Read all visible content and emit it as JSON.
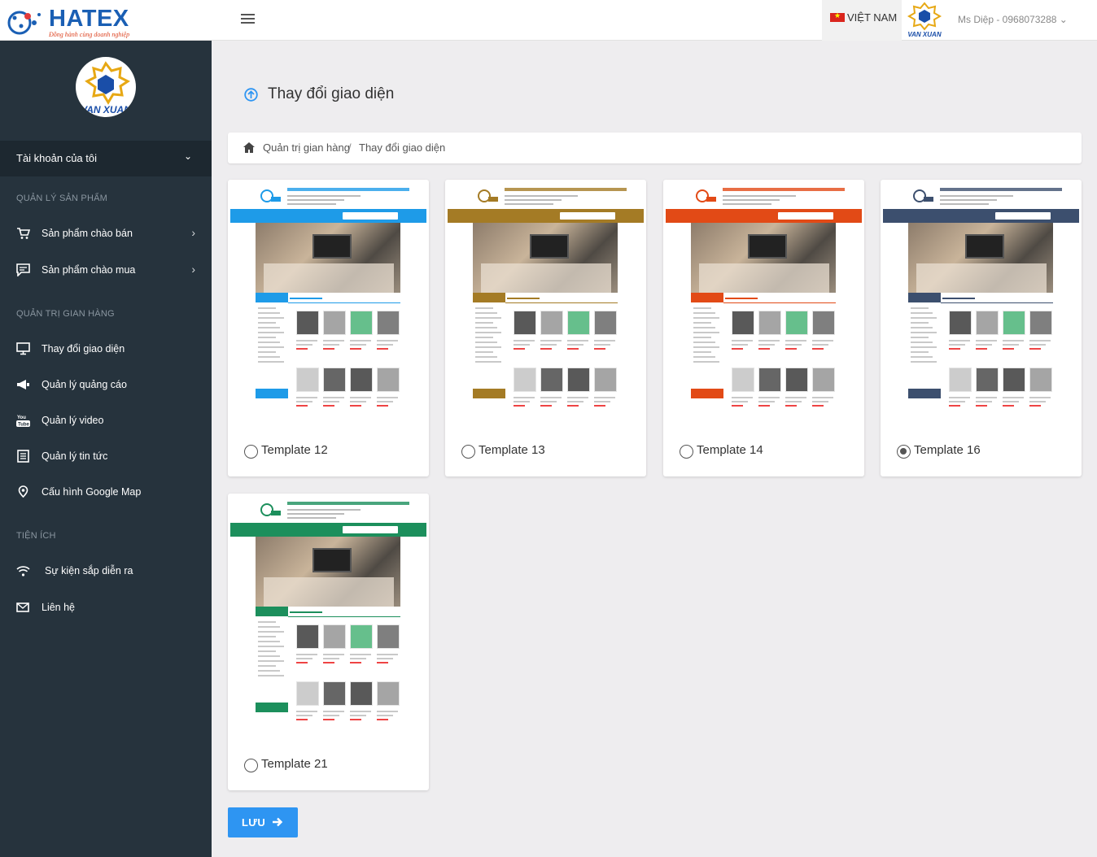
{
  "header": {
    "logo_text": "HATEX",
    "logo_tagline": "Đồng hành cùng doanh nghiệp",
    "language": "VIỆT NAM",
    "brand_text": "VAN XUAN",
    "user_label": "Ms Diệp - 0968073288"
  },
  "sidebar": {
    "avatar_text": "VAN XUAN",
    "account_label": "Tài khoản của tôi",
    "sections": {
      "products": "QUẢN LÝ SẢN PHẨM",
      "store_admin": "QUẢN TRỊ GIAN HÀNG",
      "utilities": "TIỆN ÍCH"
    },
    "items": [
      {
        "label": "Sản phẩm chào bán",
        "icon": "cart-icon"
      },
      {
        "label": "Sản phẩm chào mua",
        "icon": "chat-icon"
      },
      {
        "label": "Thay đổi giao diện",
        "icon": "monitor-icon"
      },
      {
        "label": "Quản lý quảng cáo",
        "icon": "megaphone-icon"
      },
      {
        "label": "Quản lý video",
        "icon": "youtube-icon"
      },
      {
        "label": "Quản lý tin tức",
        "icon": "news-icon"
      },
      {
        "label": "Cấu hình Google Map",
        "icon": "map-pin-icon"
      },
      {
        "label": "Sự kiện sắp diễn ra",
        "icon": "wifi-icon"
      },
      {
        "label": "Liên hệ",
        "icon": "envelope-icon"
      }
    ]
  },
  "main": {
    "page_title": "Thay đổi giao diện",
    "breadcrumb": {
      "parent": "Quản trị gian hàng",
      "separator": "/",
      "current": "Thay đổi giao diện"
    },
    "templates": [
      {
        "label": "Template 12",
        "checked": false,
        "accent": "#1e9be8"
      },
      {
        "label": "Template 13",
        "checked": false,
        "accent": "#a47b25"
      },
      {
        "label": "Template 14",
        "checked": false,
        "accent": "#e24a16"
      },
      {
        "label": "Template 16",
        "checked": true,
        "accent": "#3c4f6e"
      },
      {
        "label": "Template 21",
        "checked": false,
        "accent": "#1c8f5c"
      }
    ],
    "save_label": "LƯU"
  },
  "colors": {
    "sidebar_bg": "#26333d",
    "primary": "#2e95f2",
    "page_bg": "#eeedef"
  }
}
